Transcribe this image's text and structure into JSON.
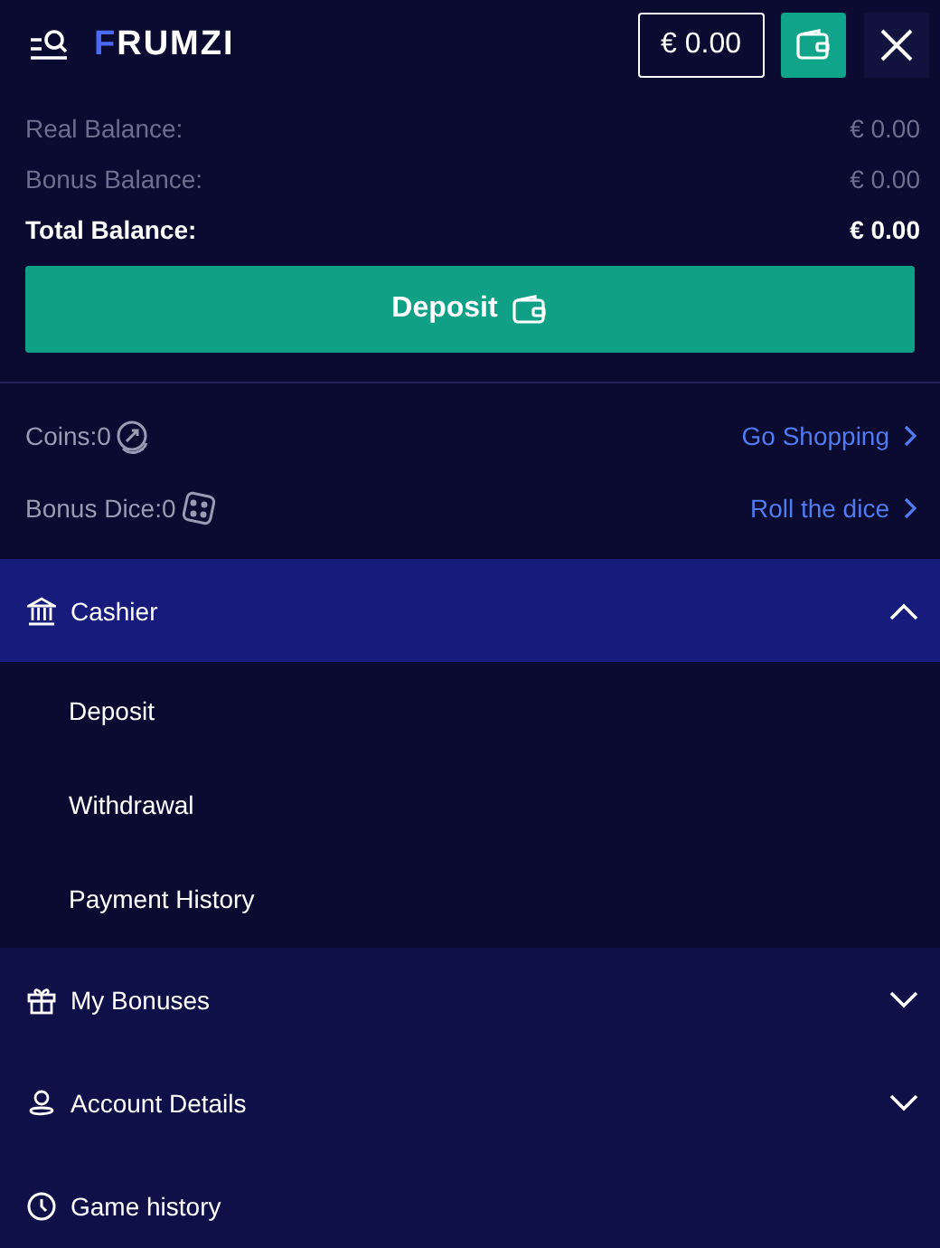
{
  "header": {
    "logo": "FRUMZI",
    "balance": "€ 0.00"
  },
  "balances": [
    {
      "label": "Real Balance:",
      "value": "€ 0.00",
      "total": false
    },
    {
      "label": "Bonus Balance:",
      "value": "€ 0.00",
      "total": false
    },
    {
      "label": "Total Balance:",
      "value": "€ 0.00",
      "total": true
    }
  ],
  "deposit_button": "Deposit",
  "rewards": [
    {
      "kind": "coins",
      "label": "Coins:0",
      "link": "Go Shopping"
    },
    {
      "kind": "dice",
      "label": "Bonus Dice:0",
      "link": "Roll the dice"
    }
  ],
  "menu": [
    {
      "label": "Cashier",
      "kind": "section",
      "expanded": true,
      "children": [
        {
          "label": "Deposit"
        },
        {
          "label": "Withdrawal"
        },
        {
          "label": "Payment History"
        }
      ]
    },
    {
      "label": "My Bonuses",
      "kind": "section",
      "expanded": false
    },
    {
      "label": "Account Details",
      "kind": "section",
      "expanded": false
    },
    {
      "label": "Game history",
      "kind": "link"
    }
  ]
}
